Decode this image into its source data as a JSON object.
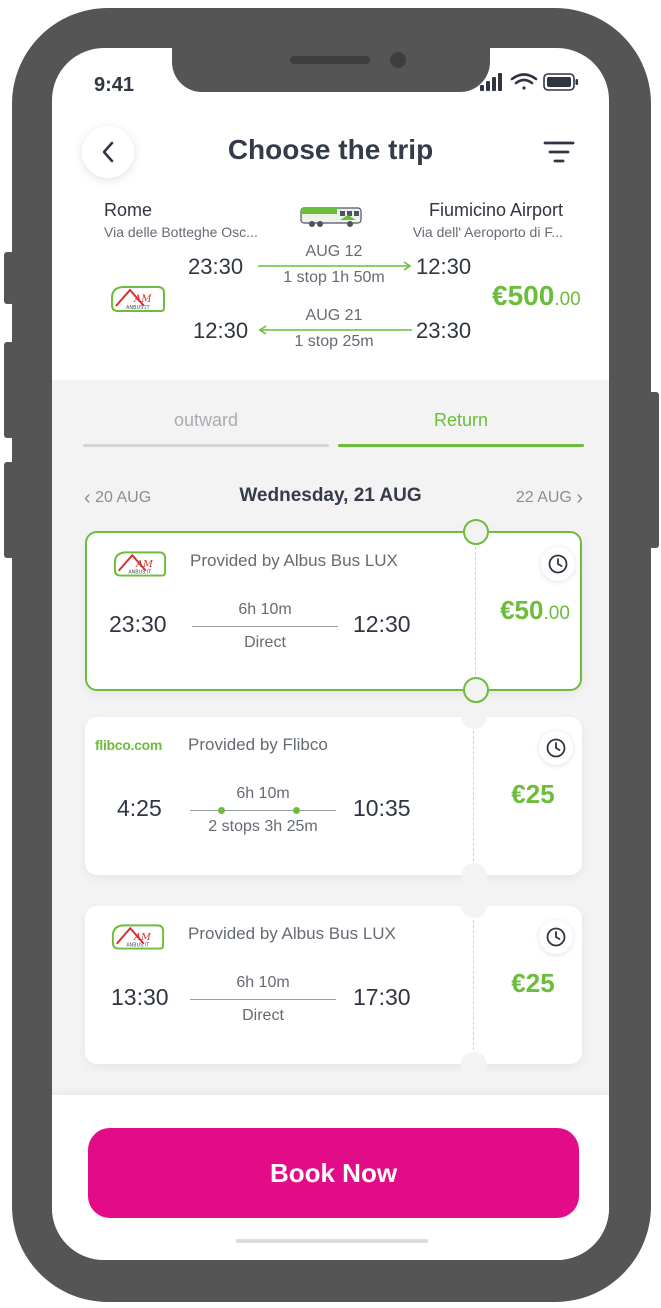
{
  "status": {
    "time": "9:41"
  },
  "header": {
    "title": "Choose the trip"
  },
  "route": {
    "from_city": "Rome",
    "from_street": "Via delle Botteghe Osc...",
    "to_city": "Fiumicino Airport",
    "to_street": "Via dell' Aeroporto di F..."
  },
  "outbound": {
    "date": "AUG 12",
    "depart": "23:30",
    "arrive": "12:30",
    "stops": "1 stop 1h 50m"
  },
  "inbound": {
    "date": "AUG 21",
    "depart": "12:30",
    "arrive": "23:30",
    "stops": "1 stop 25m"
  },
  "total_price": {
    "main": "€500",
    "cents": ".00"
  },
  "tabs": {
    "outward": "outward",
    "return": "Return",
    "active": "return"
  },
  "date_nav": {
    "prev": "20 AUG",
    "current": "Wednesday, 21 AUG",
    "next": "22 AUG"
  },
  "trips": [
    {
      "provider": "Provided by Albus Bus LUX",
      "logo": "albus-logo",
      "depart": "23:30",
      "arrive": "12:30",
      "duration": "6h 10m",
      "stops": "Direct",
      "price": "€50",
      "cents": ".00",
      "selected": true
    },
    {
      "provider": "Provided by Flibco",
      "logo_text": "flibco.com",
      "depart": "4:25",
      "arrive": "10:35",
      "duration": "6h 10m",
      "stops": "2 stops 3h 25m",
      "price": "€25",
      "cents": "",
      "selected": false
    },
    {
      "provider": "Provided by Albus Bus LUX",
      "logo": "albus-logo",
      "depart": "13:30",
      "arrive": "17:30",
      "duration": "6h 10m",
      "stops": "Direct",
      "price": "€25",
      "cents": "",
      "selected": false
    }
  ],
  "cta": {
    "label": "Book Now"
  },
  "colors": {
    "accent_green": "#6bbd3b",
    "cta_pink": "#e20c88",
    "device": "#555555",
    "text_dark": "#2f3542"
  }
}
